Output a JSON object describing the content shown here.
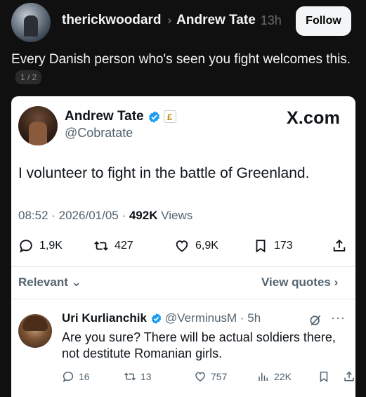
{
  "thread": {
    "username": "therickwoodard",
    "reply_to": "Andrew Tate",
    "time_ago": "13h",
    "follow_label": "Follow",
    "post_text": "Every Danish person who's seen you fight welcomes this.",
    "page_indicator": "1 / 2"
  },
  "tweet": {
    "author_name": "Andrew Tate",
    "author_handle": "@Cobratate",
    "brand": "X.com",
    "body": "I volunteer to fight in the battle of Greenland.",
    "timestamp": "08:52 · 2026/01/05 · ",
    "views_count": "492K",
    "views_label": "Views",
    "stats": {
      "replies": "1,9K",
      "reposts": "427",
      "likes": "6,9K",
      "bookmarks": "173"
    },
    "sort_label": "Relevant",
    "view_quotes_label": "View quotes"
  },
  "reply": {
    "name": "Uri Kurlianchik",
    "handle_time": "@VerminusM · 5h",
    "text": "Are you sure? There will be actual soldiers there, not destitute Romanian girls.",
    "stats": {
      "replies": "16",
      "reposts": "13",
      "likes": "757",
      "views": "22K"
    }
  },
  "icons": {
    "verified": "verified-badge-icon",
    "government": "government-badge-icon",
    "reply": "reply-icon",
    "repost": "repost-icon",
    "like": "heart-icon",
    "bookmark": "bookmark-icon",
    "share": "share-icon",
    "views": "views-bar-icon",
    "grok": "grok-icon",
    "more": "more-dots-icon"
  },
  "colors": {
    "background": "#101010",
    "card": "#ffffff",
    "verified_blue": "#1d9bf0",
    "secondary_text": "#536471"
  }
}
